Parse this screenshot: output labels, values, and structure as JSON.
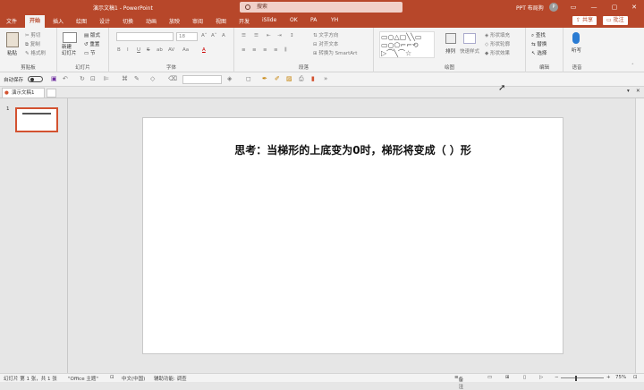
{
  "title_bar": {
    "doc_title": "演示文稿1  -  PowerPoint",
    "search_placeholder": "搜索",
    "user_name": "PPT 布局狗",
    "avatar": "P",
    "win_buttons": [
      "ribbon-display",
      "minimize",
      "restore",
      "close"
    ]
  },
  "tabs": [
    "文件",
    "开始",
    "插入",
    "绘图",
    "设计",
    "切换",
    "动画",
    "放映",
    "审阅",
    "视图",
    "开发",
    "iSlide",
    "OK",
    "PA",
    "YH"
  ],
  "share_label": "共享",
  "comment_label": "批注",
  "ribbon": {
    "clipboard": {
      "paste": "粘贴",
      "cut": "剪切",
      "copy": "复制",
      "painter": "格式刷",
      "label": "剪贴板"
    },
    "slides": {
      "new": "新建\n幻灯片",
      "layout": "版式",
      "reset": "重置",
      "section": "节",
      "label": "幻灯片"
    },
    "font": {
      "size": "18",
      "label": "字体",
      "buttons": [
        "B",
        "I",
        "U",
        "S",
        "ab",
        "AV",
        "Aa",
        "A"
      ]
    },
    "paragraph": {
      "text_dir": "文字方向",
      "align_text": "对齐文本",
      "smartart": "转换为 SmartArt",
      "label": "段落"
    },
    "drawing": {
      "arrange": "排列",
      "quick_styles": "快速样式",
      "fill": "形状填充",
      "outline": "形状轮廓",
      "effects": "形状效果",
      "label": "绘图"
    },
    "editing": {
      "find": "查找",
      "replace": "替换",
      "select": "选择",
      "label": "编辑"
    },
    "voice": {
      "dictate": "听写",
      "label": "语音"
    }
  },
  "qat": {
    "autosave": "自动保存",
    "toggle": "关"
  },
  "doc_tab": "演示文稿1",
  "slide_number": "1",
  "slide_title": "思考：当梯形的上底变为0时，梯形将变成（    ）形",
  "status": {
    "slide_info": "幻灯片 第 1 张，共 1 张",
    "theme": "\"Office 主题\"",
    "lang": "中文(中国)",
    "accessibility": "辅助功能: 调查",
    "notes": "备注",
    "zoom": "75%"
  }
}
